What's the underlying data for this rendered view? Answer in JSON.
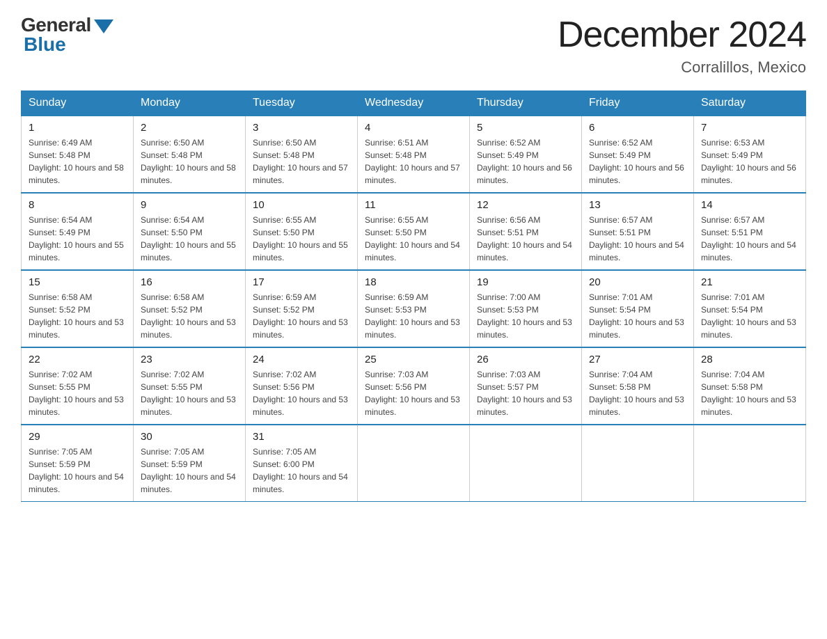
{
  "header": {
    "logo_general": "General",
    "logo_blue": "Blue",
    "month_title": "December 2024",
    "location": "Corralillos, Mexico"
  },
  "weekdays": [
    "Sunday",
    "Monday",
    "Tuesday",
    "Wednesday",
    "Thursday",
    "Friday",
    "Saturday"
  ],
  "weeks": [
    [
      {
        "day": "1",
        "sunrise": "6:49 AM",
        "sunset": "5:48 PM",
        "daylight": "10 hours and 58 minutes."
      },
      {
        "day": "2",
        "sunrise": "6:50 AM",
        "sunset": "5:48 PM",
        "daylight": "10 hours and 58 minutes."
      },
      {
        "day": "3",
        "sunrise": "6:50 AM",
        "sunset": "5:48 PM",
        "daylight": "10 hours and 57 minutes."
      },
      {
        "day": "4",
        "sunrise": "6:51 AM",
        "sunset": "5:48 PM",
        "daylight": "10 hours and 57 minutes."
      },
      {
        "day": "5",
        "sunrise": "6:52 AM",
        "sunset": "5:49 PM",
        "daylight": "10 hours and 56 minutes."
      },
      {
        "day": "6",
        "sunrise": "6:52 AM",
        "sunset": "5:49 PM",
        "daylight": "10 hours and 56 minutes."
      },
      {
        "day": "7",
        "sunrise": "6:53 AM",
        "sunset": "5:49 PM",
        "daylight": "10 hours and 56 minutes."
      }
    ],
    [
      {
        "day": "8",
        "sunrise": "6:54 AM",
        "sunset": "5:49 PM",
        "daylight": "10 hours and 55 minutes."
      },
      {
        "day": "9",
        "sunrise": "6:54 AM",
        "sunset": "5:50 PM",
        "daylight": "10 hours and 55 minutes."
      },
      {
        "day": "10",
        "sunrise": "6:55 AM",
        "sunset": "5:50 PM",
        "daylight": "10 hours and 55 minutes."
      },
      {
        "day": "11",
        "sunrise": "6:55 AM",
        "sunset": "5:50 PM",
        "daylight": "10 hours and 54 minutes."
      },
      {
        "day": "12",
        "sunrise": "6:56 AM",
        "sunset": "5:51 PM",
        "daylight": "10 hours and 54 minutes."
      },
      {
        "day": "13",
        "sunrise": "6:57 AM",
        "sunset": "5:51 PM",
        "daylight": "10 hours and 54 minutes."
      },
      {
        "day": "14",
        "sunrise": "6:57 AM",
        "sunset": "5:51 PM",
        "daylight": "10 hours and 54 minutes."
      }
    ],
    [
      {
        "day": "15",
        "sunrise": "6:58 AM",
        "sunset": "5:52 PM",
        "daylight": "10 hours and 53 minutes."
      },
      {
        "day": "16",
        "sunrise": "6:58 AM",
        "sunset": "5:52 PM",
        "daylight": "10 hours and 53 minutes."
      },
      {
        "day": "17",
        "sunrise": "6:59 AM",
        "sunset": "5:52 PM",
        "daylight": "10 hours and 53 minutes."
      },
      {
        "day": "18",
        "sunrise": "6:59 AM",
        "sunset": "5:53 PM",
        "daylight": "10 hours and 53 minutes."
      },
      {
        "day": "19",
        "sunrise": "7:00 AM",
        "sunset": "5:53 PM",
        "daylight": "10 hours and 53 minutes."
      },
      {
        "day": "20",
        "sunrise": "7:01 AM",
        "sunset": "5:54 PM",
        "daylight": "10 hours and 53 minutes."
      },
      {
        "day": "21",
        "sunrise": "7:01 AM",
        "sunset": "5:54 PM",
        "daylight": "10 hours and 53 minutes."
      }
    ],
    [
      {
        "day": "22",
        "sunrise": "7:02 AM",
        "sunset": "5:55 PM",
        "daylight": "10 hours and 53 minutes."
      },
      {
        "day": "23",
        "sunrise": "7:02 AM",
        "sunset": "5:55 PM",
        "daylight": "10 hours and 53 minutes."
      },
      {
        "day": "24",
        "sunrise": "7:02 AM",
        "sunset": "5:56 PM",
        "daylight": "10 hours and 53 minutes."
      },
      {
        "day": "25",
        "sunrise": "7:03 AM",
        "sunset": "5:56 PM",
        "daylight": "10 hours and 53 minutes."
      },
      {
        "day": "26",
        "sunrise": "7:03 AM",
        "sunset": "5:57 PM",
        "daylight": "10 hours and 53 minutes."
      },
      {
        "day": "27",
        "sunrise": "7:04 AM",
        "sunset": "5:58 PM",
        "daylight": "10 hours and 53 minutes."
      },
      {
        "day": "28",
        "sunrise": "7:04 AM",
        "sunset": "5:58 PM",
        "daylight": "10 hours and 53 minutes."
      }
    ],
    [
      {
        "day": "29",
        "sunrise": "7:05 AM",
        "sunset": "5:59 PM",
        "daylight": "10 hours and 54 minutes."
      },
      {
        "day": "30",
        "sunrise": "7:05 AM",
        "sunset": "5:59 PM",
        "daylight": "10 hours and 54 minutes."
      },
      {
        "day": "31",
        "sunrise": "7:05 AM",
        "sunset": "6:00 PM",
        "daylight": "10 hours and 54 minutes."
      },
      null,
      null,
      null,
      null
    ]
  ]
}
